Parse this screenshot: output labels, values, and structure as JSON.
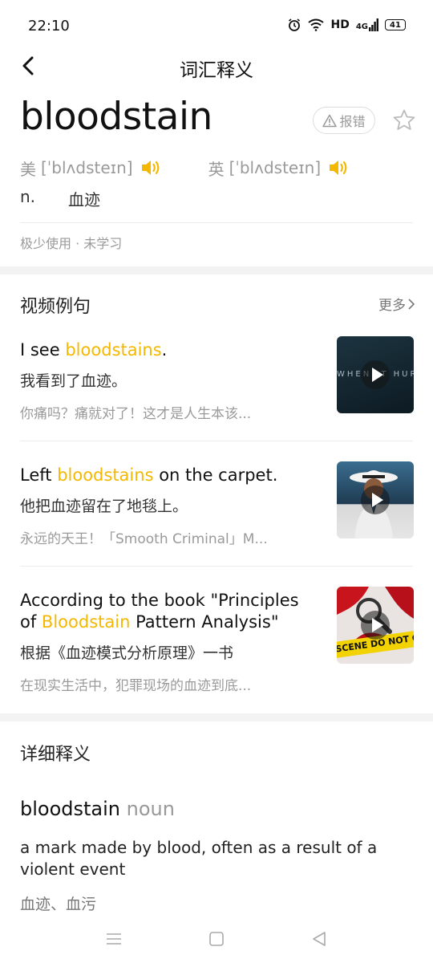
{
  "status": {
    "time": "22:10",
    "hd": "HD",
    "network": "4G",
    "battery": "41"
  },
  "nav": {
    "title": "词汇释义"
  },
  "word": {
    "headword": "bloodstain",
    "report_label": "报错",
    "us_label": "美",
    "us_phonetic": "[ˈblʌdsteɪn]",
    "uk_label": "英",
    "uk_phonetic": "[ˈblʌdsteɪn]",
    "pos": "n.",
    "meaning": "血迹",
    "usage": "极少使用 · 未学习"
  },
  "videos": {
    "title": "视频例句",
    "more_label": "更多",
    "items": [
      {
        "en_pre": "I see ",
        "en_hl": "bloodstains",
        "en_post": ".",
        "en_l2_pre": "",
        "en_l2_hl": "",
        "en_l2_post": "",
        "zh": "我看到了血迹。",
        "source": "你痛吗？痛就对了！这才是人生本该..."
      },
      {
        "en_pre": "Left ",
        "en_hl": "bloodstains",
        "en_post": " on the carpet.",
        "en_l2_pre": "",
        "en_l2_hl": "",
        "en_l2_post": "",
        "zh": "他把血迹留在了地毯上。",
        "source": "永远的天王！「Smooth Criminal」M..."
      },
      {
        "en_pre": "According to the book \"Principles",
        "en_hl": "",
        "en_post": "",
        "en_l2_pre": "of ",
        "en_l2_hl": "Bloodstain",
        "en_l2_post": " Pattern Analysis\"",
        "zh": "根据《血迹模式分析原理》一书",
        "source": "在现实生活中，犯罪现场的血迹到底..."
      }
    ],
    "thumb1_text": "WHEN IT HURTS",
    "thumb3_text": "SCENE DO NOT C"
  },
  "detail": {
    "title": "详细释义",
    "word": "bloodstain",
    "pos": "noun",
    "definition": "a mark made by blood, often as a result of a violent event",
    "translation": "血迹、血污"
  },
  "colors": {
    "accent": "#f5b800",
    "muted": "#9a9a9a"
  }
}
